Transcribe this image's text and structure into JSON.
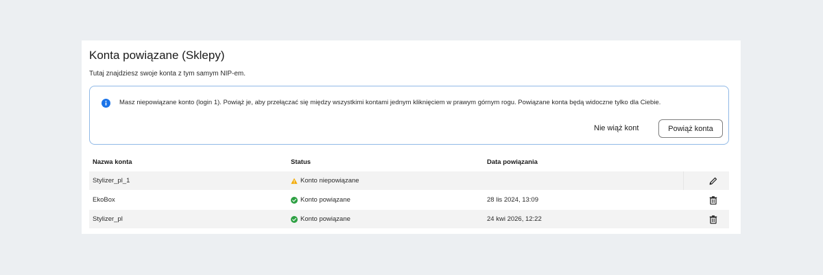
{
  "section": {
    "title": "Konta powiązane (Sklepy)",
    "subtitle": "Tutaj znajdziesz swoje konta z tym samym NIP-em."
  },
  "alert": {
    "message": "Masz niepowiązane konto (login 1). Powiąż je, aby przełączać się między wszystkimi kontami jednym kliknięciem w prawym górnym rogu. Powiązane konta będą widoczne tylko dla Ciebie.",
    "dismiss_label": "Nie wiąż kont",
    "link_label": "Powiąż konta",
    "icon": "info-icon"
  },
  "table": {
    "headers": [
      "Nazwa konta",
      "Status",
      "Data powiązania"
    ],
    "rows": [
      {
        "name": "Stylizer_pl_1",
        "status": "Konto niepowiązane",
        "status_icon": "warning-icon",
        "date": "",
        "action_icon": "pencil-icon"
      },
      {
        "name": "EkoBox",
        "status": "Konto powiązane",
        "status_icon": "check-circle-icon",
        "date": "28 lis 2024, 13:09",
        "action_icon": "trash-icon"
      },
      {
        "name": "Stylizer_pl",
        "status": "Konto powiązane",
        "status_icon": "check-circle-icon",
        "date": "24 kwi 2026, 12:22",
        "action_icon": "trash-icon"
      }
    ]
  },
  "colors": {
    "info": "#1a73e8",
    "warning": "#f2a900",
    "success": "#2ea043",
    "alert_border": "#8fb8e6",
    "page_bg": "#eceff2"
  }
}
